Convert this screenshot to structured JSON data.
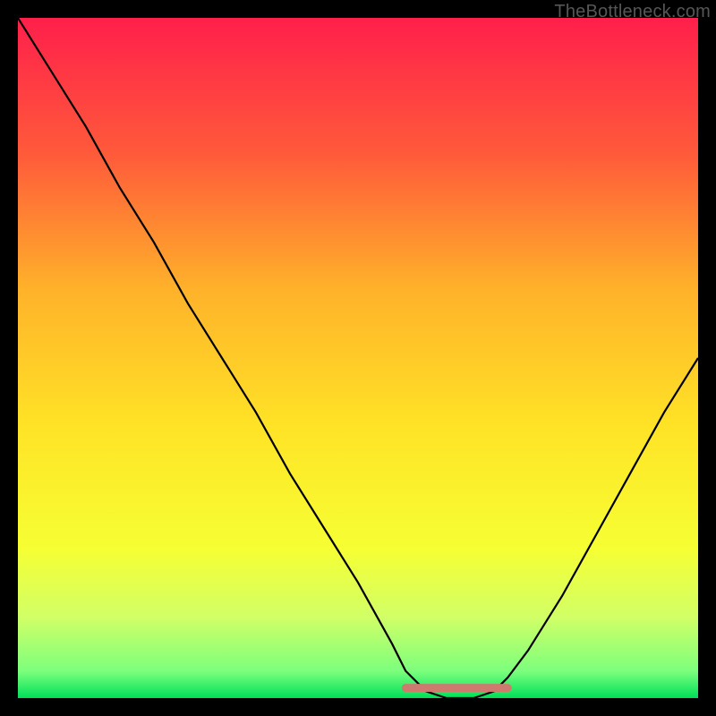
{
  "attribution": "TheBottleneck.com",
  "chart_data": {
    "type": "line",
    "title": "",
    "xlabel": "",
    "ylabel": "",
    "xlim": [
      0,
      100
    ],
    "ylim": [
      0,
      100
    ],
    "series": [
      {
        "name": "bottleneck-curve",
        "x": [
          0,
          5,
          10,
          15,
          20,
          25,
          30,
          35,
          40,
          45,
          50,
          55,
          57,
          60,
          63,
          67,
          70,
          72,
          75,
          80,
          85,
          90,
          95,
          100
        ],
        "y": [
          100,
          92,
          84,
          75,
          67,
          58,
          50,
          42,
          33,
          25,
          17,
          8,
          4,
          1,
          0,
          0,
          1,
          3,
          7,
          15,
          24,
          33,
          42,
          50
        ]
      }
    ],
    "gradient_stops": [
      {
        "offset": 0,
        "color": "#ff1f4b"
      },
      {
        "offset": 20,
        "color": "#ff5a3a"
      },
      {
        "offset": 40,
        "color": "#ffb22a"
      },
      {
        "offset": 60,
        "color": "#ffe326"
      },
      {
        "offset": 78,
        "color": "#f6ff33"
      },
      {
        "offset": 88,
        "color": "#d2ff66"
      },
      {
        "offset": 96,
        "color": "#7dff7d"
      },
      {
        "offset": 100,
        "color": "#00e05a"
      }
    ],
    "optimal_band": {
      "x_start": 57,
      "x_end": 72,
      "color": "#cf7a6f"
    }
  }
}
